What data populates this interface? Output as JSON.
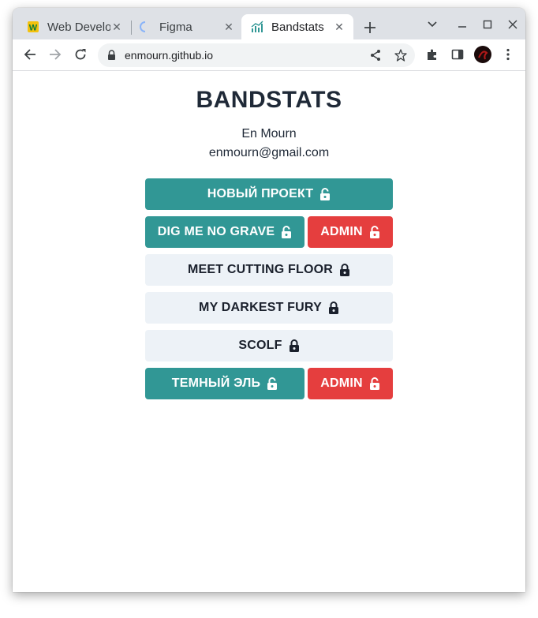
{
  "browser": {
    "tabs": [
      {
        "title": "Web Develo",
        "favicon": "w-favicon-icon"
      },
      {
        "title": "Figma",
        "favicon": "loading-spinner-icon"
      },
      {
        "title": "Bandstats",
        "favicon": "bar-chart-icon",
        "active": true
      }
    ],
    "url": "enmourn.github.io"
  },
  "page": {
    "title": "BANDSTATS",
    "user_name": "En Mourn",
    "user_email": "enmourn@gmail.com",
    "buttons": [
      {
        "label": "НОВЫЙ ПРОЕКТ",
        "style": "teal"
      },
      {
        "label": "DIG ME NO GRAVE",
        "style": "teal",
        "admin_label": "ADMIN"
      },
      {
        "label": "MEET CUTTING FLOOR",
        "style": "gray"
      },
      {
        "label": "MY DARKEST FURY",
        "style": "gray"
      },
      {
        "label": "SCOLF",
        "style": "gray"
      },
      {
        "label": "ТЕМНЫЙ ЭЛЬ",
        "style": "teal",
        "admin_label": "ADMIN"
      }
    ]
  },
  "colors": {
    "teal": "#319795",
    "red": "#e53e3e",
    "gray": "#edf2f7",
    "text_dark": "#1f2937"
  }
}
